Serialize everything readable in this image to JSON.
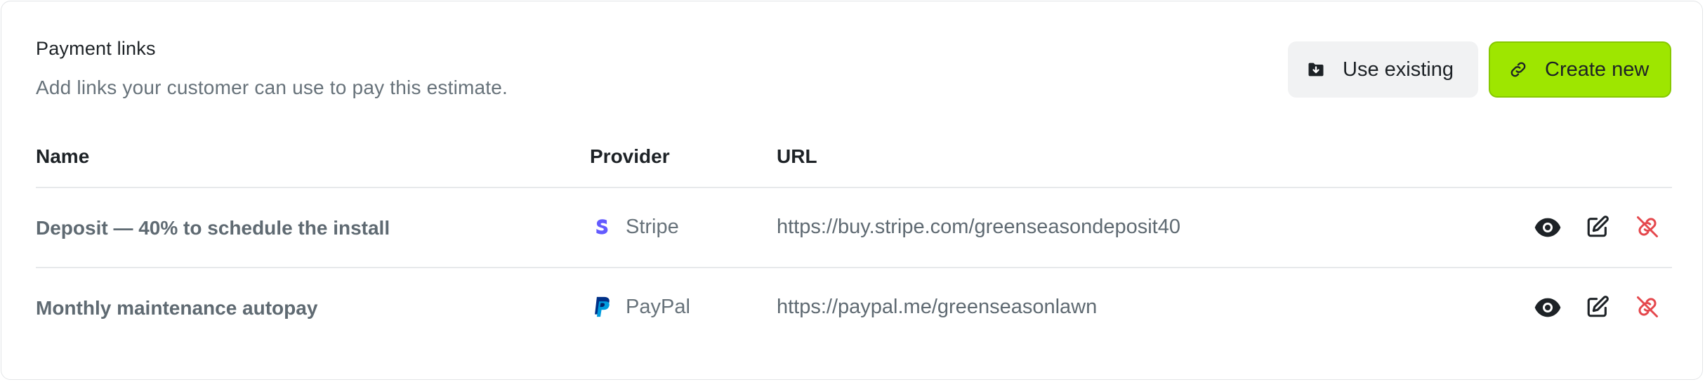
{
  "section": {
    "title": "Payment links",
    "subtitle": "Add links your customer can use to pay this estimate."
  },
  "actions": {
    "use_existing_label": "Use existing",
    "create_new_label": "Create new"
  },
  "table": {
    "columns": [
      "Name",
      "Provider",
      "URL"
    ],
    "rows": [
      {
        "name": "Deposit — 40% to schedule the install",
        "provider": "Stripe",
        "provider_icon": "stripe-logo",
        "url": "https://buy.stripe.com/greenseasondeposit40"
      },
      {
        "name": "Monthly maintenance autopay",
        "provider": "PayPal",
        "provider_icon": "paypal-logo",
        "url": "https://paypal.me/greenseasonlawn"
      }
    ],
    "row_actions": [
      "eye-icon",
      "edit-icon",
      "unlink-icon"
    ]
  },
  "colors": {
    "accent": "#9ee600",
    "danger": "#e5484d",
    "stripe": "#635bff",
    "paypal_dark": "#003087",
    "paypal_light": "#009cde"
  }
}
